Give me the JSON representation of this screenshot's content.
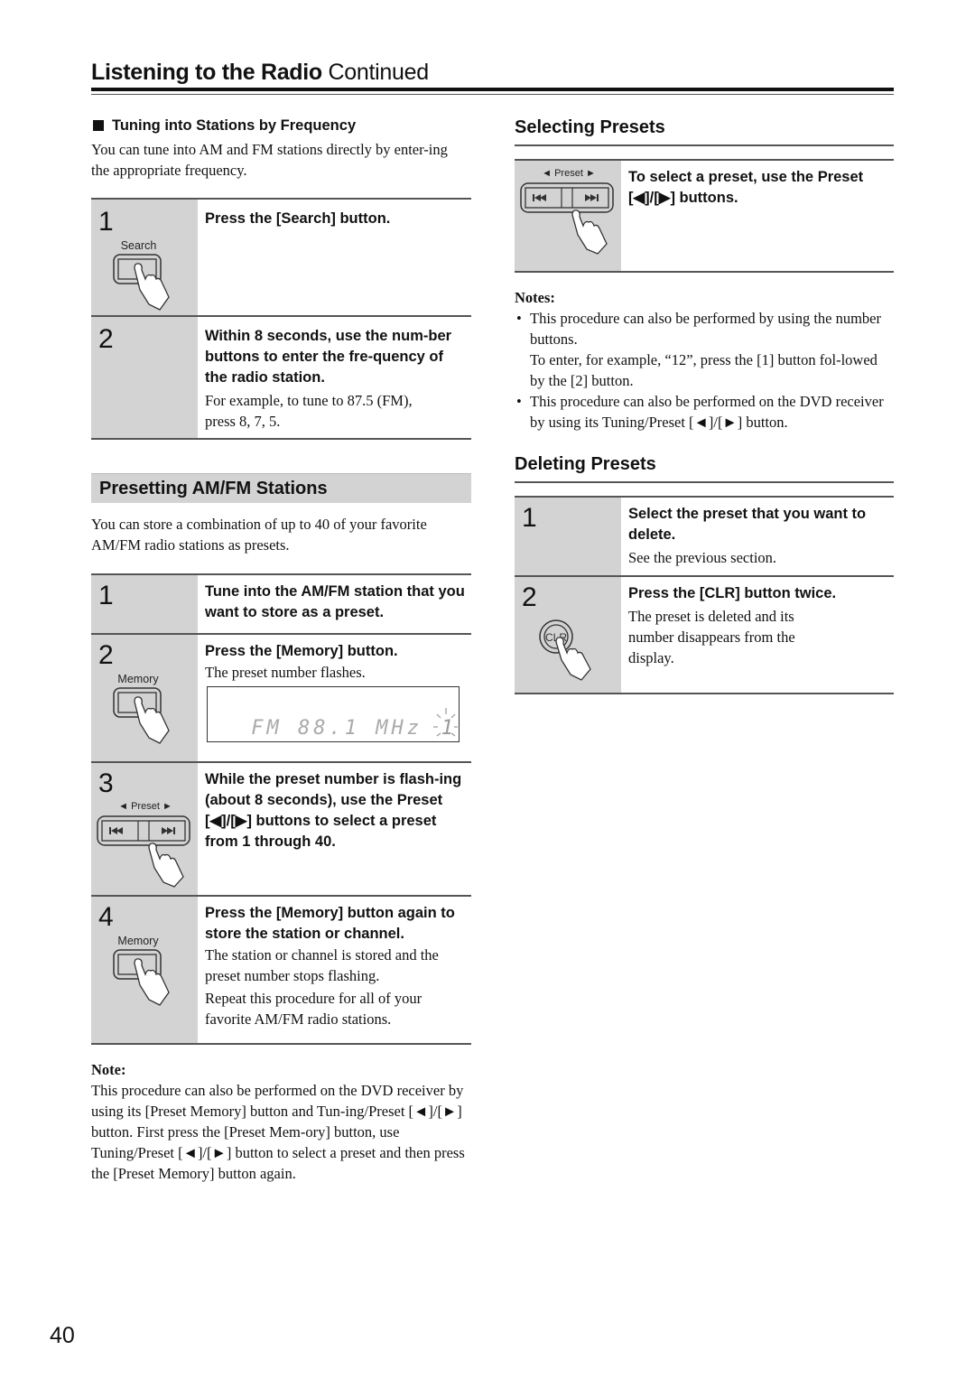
{
  "header": {
    "title_bold": "Listening to the Radio",
    "title_suffix": "Continued"
  },
  "tuning": {
    "heading": "Tuning into Stations by Frequency",
    "intro": "You can tune into AM and FM stations directly by enter-ing the appropriate frequency.",
    "steps": [
      {
        "number": "1",
        "illustration_label": "Search",
        "instruction": "Press the [Search] button."
      },
      {
        "number": "2",
        "instruction": "Within 8 seconds, use the num-ber buttons to enter the fre-quency of the radio station.",
        "description": "For example, to tune to 87.5 (FM), press 8, 7, 5."
      }
    ]
  },
  "presetting": {
    "heading": "Presetting AM/FM Stations",
    "intro": "You can store a combination of up to 40 of your favorite AM/FM radio stations as presets.",
    "steps": [
      {
        "number": "1",
        "instruction": "Tune into the AM/FM station that you want to store as a preset."
      },
      {
        "number": "2",
        "illustration_label": "Memory",
        "instruction": "Press the [Memory] button.",
        "description": "The preset number flashes.",
        "display": {
          "text": "FM 88.1 MHz",
          "preset": "1"
        }
      },
      {
        "number": "3",
        "illustration_label": "◄ Preset ►",
        "instruction": "While the preset number is flash-ing (about 8 seconds), use the Preset [◀]/[▶] buttons to select a preset from 1 through 40."
      },
      {
        "number": "4",
        "illustration_label": "Memory",
        "instruction": "Press the [Memory] button again to store the station or channel.",
        "description": "The station or channel is stored and the preset number stops flashing.",
        "description2": "Repeat this procedure for all of your favorite AM/FM radio stations."
      }
    ],
    "note_title": "Note:",
    "note_text": "This procedure can also be performed on the DVD receiver by using its [Preset Memory] button and Tun-ing/Preset [◄]/[►] button. First press the [Preset Mem-ory] button, use Tuning/Preset [◄]/[►] button to select a preset and then press the [Preset Memory] button again."
  },
  "selecting": {
    "heading": "Selecting Presets",
    "illustration_label": "◄ Preset ►",
    "instruction": "To select a preset, use the Preset [◀]/[▶] buttons.",
    "notes_title": "Notes:",
    "notes": [
      {
        "text": "This procedure can also be performed by using the number buttons.",
        "text2": "To enter, for example, “12”, press the [1] button fol-lowed by the [2] button."
      },
      {
        "text": "This procedure can also be performed on the DVD receiver by using its Tuning/Preset [◄]/[►] button."
      }
    ]
  },
  "deleting": {
    "heading": "Deleting Presets",
    "steps": [
      {
        "number": "1",
        "instruction": "Select the preset that you want to delete.",
        "description": "See the previous section."
      },
      {
        "number": "2",
        "illustration_label": "CLR",
        "instruction": "Press the [CLR] button twice.",
        "description": "The preset is deleted and its number disappears from the display."
      }
    ]
  },
  "page_number": "40"
}
